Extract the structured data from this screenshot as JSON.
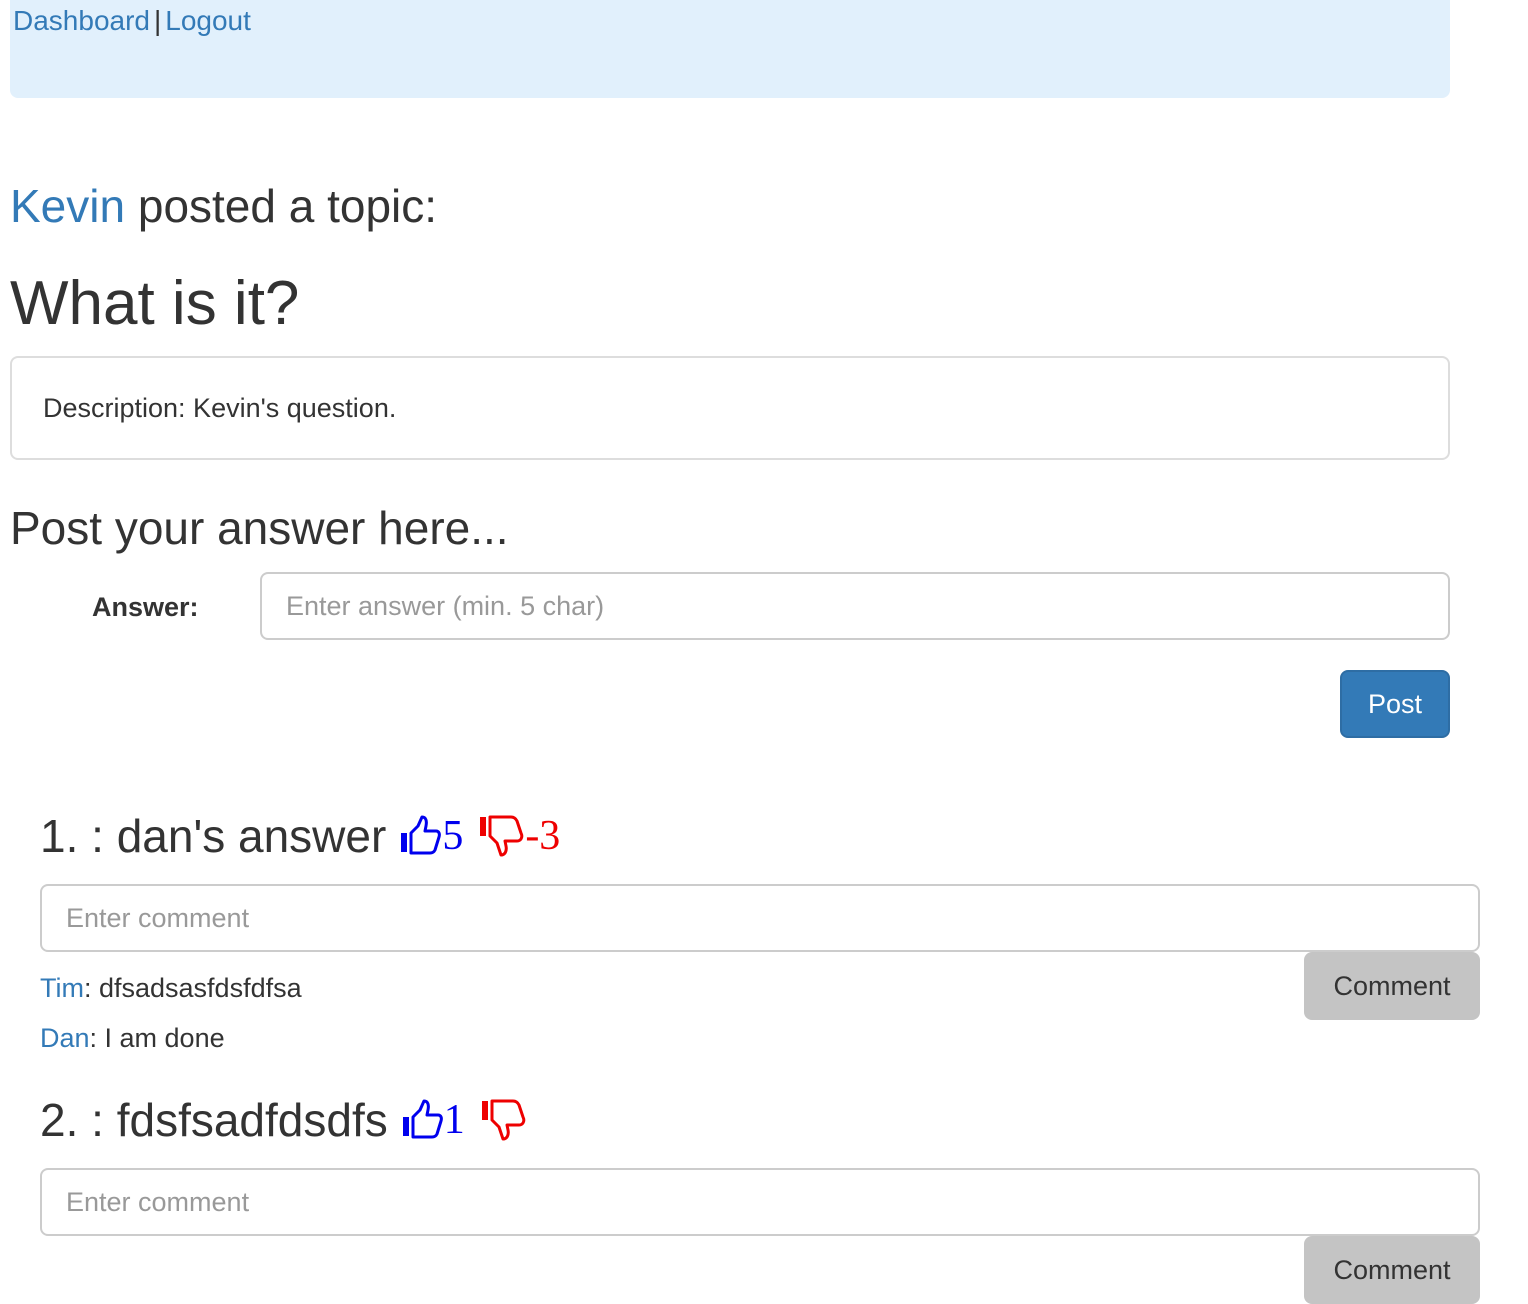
{
  "nav": {
    "dashboard_label": "Dashboard",
    "separator": "|",
    "logout_label": "Logout"
  },
  "topic": {
    "author": "Kevin",
    "posted_text": " posted a topic:",
    "title": "What is it?",
    "description": "Description: Kevin's question."
  },
  "answer_form": {
    "heading": "Post your answer here...",
    "label": "Answer:",
    "placeholder": "Enter answer (min. 5 char)",
    "post_label": "Post"
  },
  "answers": [
    {
      "title": "1. : dan's answer",
      "upvotes": "5",
      "downvotes": "-3",
      "comment_placeholder": "Enter comment",
      "comment_button_label": "Comment",
      "comments": [
        {
          "user": "Tim",
          "text": ": dfsadsasfdsfdfsa"
        },
        {
          "user": "Dan",
          "text": ": I am done"
        }
      ]
    },
    {
      "title": "2. : fdsfsadfdsdfs",
      "upvotes": "1",
      "downvotes": "",
      "comment_placeholder": "Enter comment",
      "comment_button_label": "Comment",
      "comments": []
    }
  ],
  "icons": {
    "upvote": "thumbs-up-icon",
    "downvote": "thumbs-down-icon"
  },
  "colors": {
    "nav_background": "#e1f0fc",
    "link": "#337ab7",
    "primary_button": "#337ab7",
    "secondary_button": "#c4c4c4",
    "upvote": "#0000ee",
    "downvote": "#ee0000"
  }
}
